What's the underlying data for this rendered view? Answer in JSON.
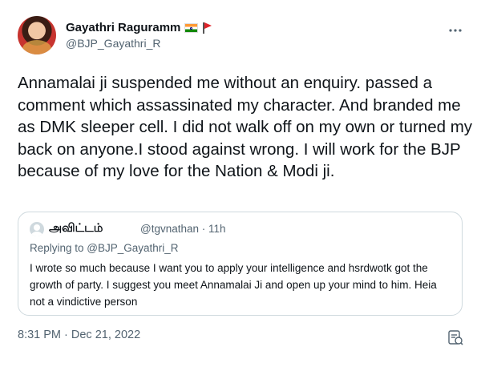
{
  "author": {
    "name": "Gayathri Raguramm",
    "handle": "@BJP_Gayathri_R",
    "badges": [
      "india-flag-icon",
      "red-flag-icon"
    ]
  },
  "tweet": {
    "text": "Annamalai ji suspended me without an enquiry. passed a comment which assassinated my character. And branded me as DMK sleeper cell. I did not walk off on my own or turned my back on anyone.I stood against wrong. I will work for the BJP because of my love for the Nation & Modi ji.",
    "timestamp": "8:31 PM · Dec 21, 2022"
  },
  "quoted": {
    "name": "அவிட்டம்",
    "meta": "@tgvnathan · 11h",
    "replying_to": "Replying to @BJP_Gayathri_R",
    "text": "I wrote so much because I want you to apply your intelligence and hsrdwotk got the growth of party.  I suggest you meet Annamalai Ji and open up your mind to him.  Heia not a vindictive person"
  },
  "icons": {
    "more": "more-icon",
    "analytics": "analytics-icon"
  },
  "colors": {
    "text_primary": "#0f1419",
    "text_secondary": "#536471",
    "border": "#cfd9de"
  }
}
